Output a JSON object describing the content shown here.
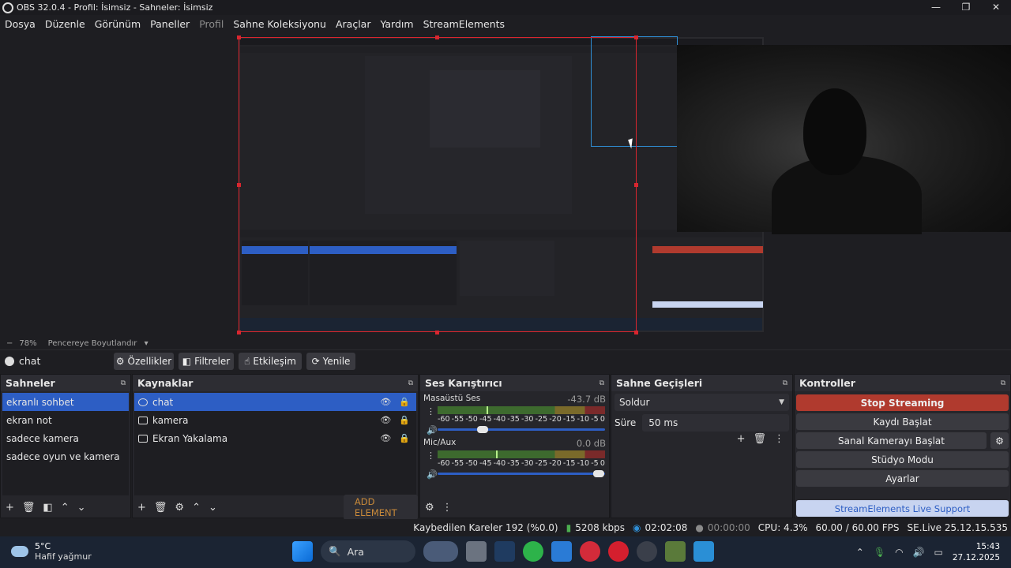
{
  "window": {
    "title": "OBS 32.0.4 - Profil: İsimsiz - Sahneler: İsimsiz"
  },
  "menu": [
    "Dosya",
    "Düzenle",
    "Görünüm",
    "Paneller",
    "Profil",
    "Sahne Koleksiyonu",
    "Araçlar",
    "Yardım",
    "StreamElements"
  ],
  "zoom": {
    "value": "78%",
    "mode": "Pencereye Boyutlandır"
  },
  "source_toolbar": {
    "current": "chat",
    "properties": "Özellikler",
    "filters": "Filtreler",
    "interact": "Etkileşim",
    "refresh": "Yenile"
  },
  "scenes": {
    "title": "Sahneler",
    "items": [
      "ekranlı sohbet",
      "ekran not",
      "sadece kamera",
      "sadece oyun ve kamera"
    ],
    "selected": 0
  },
  "sources": {
    "title": "Kaynaklar",
    "items": [
      "chat",
      "kamera",
      "Ekran Yakalama"
    ],
    "add_element": "ADD ELEMENT"
  },
  "mixer": {
    "title": "Ses Karıştırıcı",
    "channels": [
      {
        "name": "Masaüstü Ses",
        "db": "-43.7 dB",
        "level": 0.3,
        "volume": 0.27
      },
      {
        "name": "Mic/Aux",
        "db": "0.0 dB",
        "level": 0.36,
        "volume": 0.96
      }
    ],
    "scale": [
      "-60",
      "-55",
      "-50",
      "-45",
      "-40",
      "-35",
      "-30",
      "-25",
      "-20",
      "-15",
      "-10",
      "-5",
      "0"
    ]
  },
  "transitions": {
    "title": "Sahne Geçişleri",
    "selected": "Soldur",
    "duration_label": "Süre",
    "duration_value": "50 ms"
  },
  "controls": {
    "title": "Kontroller",
    "stop_streaming": "Stop Streaming",
    "start_recording": "Kaydı Başlat",
    "start_virtual_cam": "Sanal Kamerayı Başlat",
    "studio_mode": "Stüdyo Modu",
    "settings": "Ayarlar",
    "se_support": "StreamElements Live Support"
  },
  "status": {
    "dropped_frames": "Kaybedilen Kareler 192 (%0.0)",
    "bitrate": "5208 kbps",
    "stream_time": "02:02:08",
    "rec_time": "00:00:00",
    "cpu": "CPU: 4.3%",
    "fps": "60.00 / 60.00 FPS",
    "se_version": "SE.Live 25.12.15.535"
  },
  "taskbar": {
    "temp": "5°C",
    "weather": "Hafif yağmur",
    "search": "Ara",
    "time": "15:43",
    "date": "27.12.2025"
  },
  "colors": {
    "accent": "#2d5ec4",
    "stop": "#b03a2e",
    "selection_red": "#d9262f",
    "selection_blue": "#2f8fd6"
  }
}
